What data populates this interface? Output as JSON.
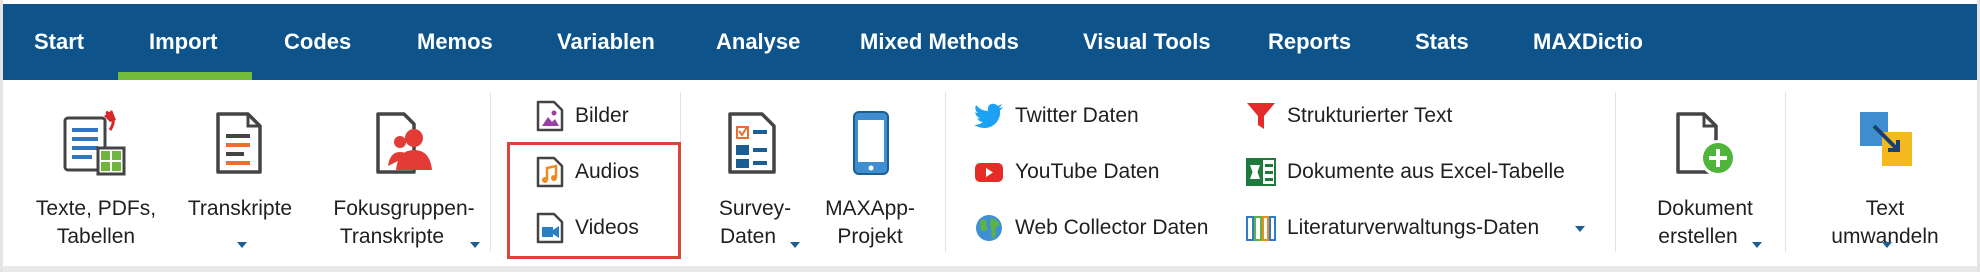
{
  "tabs": [
    {
      "label": "Start",
      "active": false
    },
    {
      "label": "Import",
      "active": true
    },
    {
      "label": "Codes",
      "active": false
    },
    {
      "label": "Memos",
      "active": false
    },
    {
      "label": "Variablen",
      "active": false
    },
    {
      "label": "Analyse",
      "active": false
    },
    {
      "label": "Mixed Methods",
      "active": false
    },
    {
      "label": "Visual Tools",
      "active": false
    },
    {
      "label": "Reports",
      "active": false
    },
    {
      "label": "Stats",
      "active": false
    },
    {
      "label": "MAXDictio",
      "active": false
    }
  ],
  "ribbon": {
    "texte": {
      "line1": "Texte, PDFs,",
      "line2": "Tabellen",
      "icon": "documents-pdf-table-icon"
    },
    "transkripte": {
      "line1": "Transkripte",
      "icon": "transcript-icon"
    },
    "fokus": {
      "line1": "Fokusgruppen-",
      "line2": "Transkripte",
      "icon": "focus-group-icon"
    },
    "bilder": {
      "label": "Bilder",
      "icon": "image-file-icon"
    },
    "audios": {
      "label": "Audios",
      "icon": "audio-file-icon"
    },
    "videos": {
      "label": "Videos",
      "icon": "video-file-icon"
    },
    "survey": {
      "line1": "Survey-",
      "line2": "Daten",
      "icon": "survey-icon"
    },
    "maxapp": {
      "line1": "MAXApp-",
      "line2": "Projekt",
      "icon": "smartphone-icon"
    },
    "twitter": {
      "label": "Twitter Daten",
      "icon": "twitter-bird-icon"
    },
    "youtube": {
      "label": "YouTube Daten",
      "icon": "youtube-icon"
    },
    "webcollector": {
      "label": "Web Collector Daten",
      "icon": "globe-icon"
    },
    "strukturiert": {
      "label": "Strukturierter Text",
      "icon": "funnel-icon"
    },
    "excel": {
      "label": "Dokumente aus Excel-Tabelle",
      "icon": "excel-icon"
    },
    "literatur": {
      "label": "Literaturverwaltungs-Daten",
      "icon": "bookshelf-icon"
    },
    "dokument": {
      "line1": "Dokument",
      "line2": "erstellen",
      "icon": "new-document-icon"
    },
    "text": {
      "line1": "Text",
      "line2": "umwandeln",
      "icon": "convert-text-icon"
    }
  },
  "colors": {
    "tabbar": "#0e5389",
    "active_underline": "#71bc3a",
    "highlight_box": "#d7453b",
    "dropdown_arrow": "#1b5e94"
  }
}
